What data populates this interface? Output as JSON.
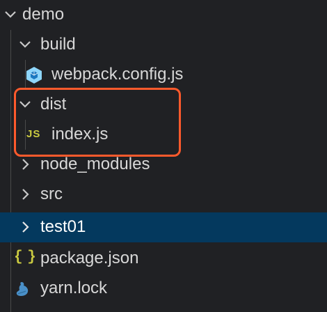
{
  "explorer": {
    "items": [
      {
        "label": "demo",
        "type": "folder",
        "expanded": true,
        "icon": "chevron-down-icon"
      },
      {
        "label": "build",
        "type": "folder",
        "expanded": true,
        "icon": "chevron-down-icon"
      },
      {
        "label": "webpack.config.js",
        "type": "file",
        "icon": "webpack-icon"
      },
      {
        "label": "dist",
        "type": "folder",
        "expanded": true,
        "icon": "chevron-down-icon"
      },
      {
        "label": "index.js",
        "type": "file",
        "icon": "js-file-icon"
      },
      {
        "label": "node_modules",
        "type": "folder",
        "expanded": false,
        "icon": "chevron-right-icon"
      },
      {
        "label": "src",
        "type": "folder",
        "expanded": false,
        "icon": "chevron-right-icon"
      },
      {
        "label": "test01",
        "type": "folder",
        "expanded": false,
        "selected": true,
        "icon": "chevron-right-icon"
      },
      {
        "label": "package.json",
        "type": "file",
        "icon": "json-file-icon"
      },
      {
        "label": "yarn.lock",
        "type": "file",
        "icon": "yarn-icon"
      }
    ],
    "js_icon_text": "JS",
    "json_icon_text": "{ }"
  },
  "colors": {
    "background": "#202124",
    "selected_row": "#04395e",
    "highlight_border": "#ff5a2c",
    "js_icon": "#cbcb41",
    "webpack_icon": "#8ed6fb"
  }
}
